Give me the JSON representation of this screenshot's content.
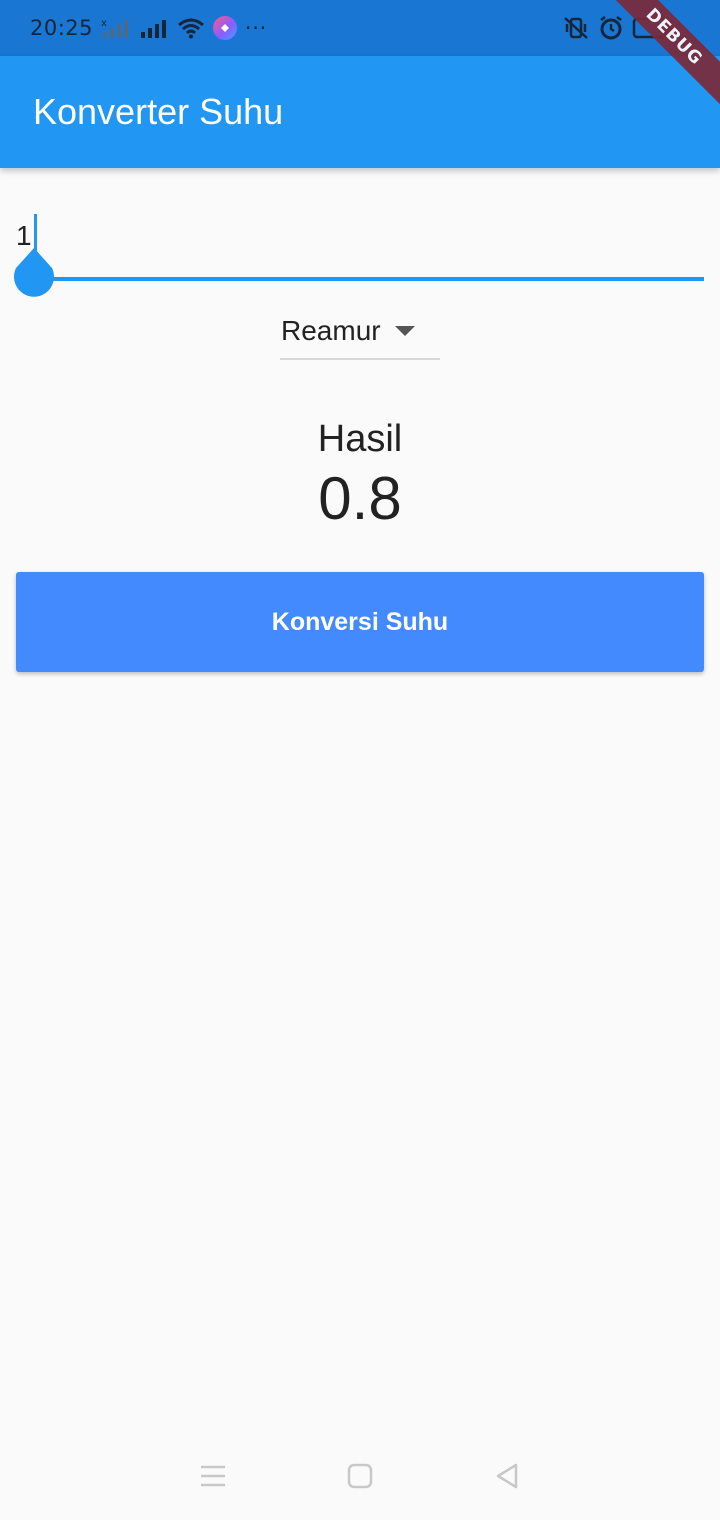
{
  "status_bar": {
    "time": "20:25",
    "icons": [
      "signal-crossed-icon",
      "signal-icon",
      "wifi-icon",
      "app-badge-icon",
      "more-icon",
      "vibrate-off-icon",
      "alarm-icon",
      "battery-icon"
    ],
    "more": "···"
  },
  "debug_banner": "DEBUG",
  "app_bar": {
    "title": "Konverter Suhu"
  },
  "input": {
    "value": "1"
  },
  "dropdown": {
    "selected": "Reamur"
  },
  "result": {
    "label": "Hasil",
    "value": "0.8"
  },
  "button": {
    "label": "Konversi Suhu"
  },
  "nav_bar": {
    "icons": [
      "menu-icon",
      "home-icon",
      "back-icon"
    ]
  },
  "colors": {
    "primary": "#2196f3",
    "status_bar": "#1976d2",
    "button": "#448aff",
    "background": "#fafafa",
    "debug": "#7a2a3a"
  }
}
